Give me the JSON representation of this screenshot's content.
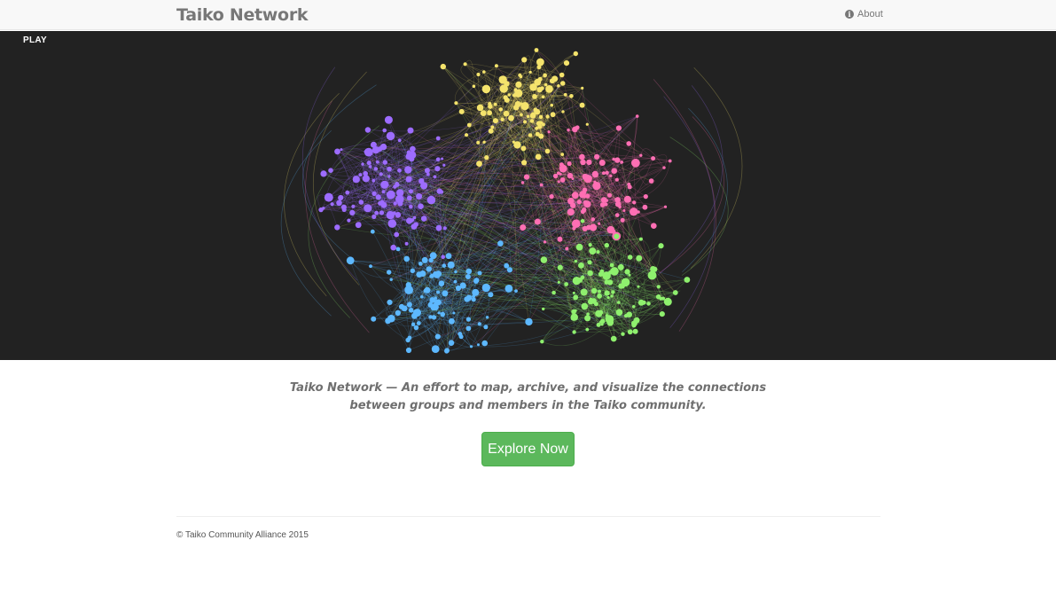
{
  "navbar": {
    "brand": "Taiko Network",
    "about_label": "About",
    "about_icon": "info-icon",
    "about_icon_glyph": "i"
  },
  "hero": {
    "play_label": "PLAY",
    "background": "#222222",
    "cluster_colors": [
      "#9d6cff",
      "#f4e36c",
      "#ff6fb4",
      "#5db8ff",
      "#8ff06e"
    ]
  },
  "main": {
    "tagline": "Taiko Network — An effort to map, archive, and visualize the connections between groups and members in the Taiko community.",
    "explore_label": "Explore Now",
    "accent_color": "#5cb85c"
  },
  "footer": {
    "copyright": "© Taiko Community Alliance 2015"
  }
}
